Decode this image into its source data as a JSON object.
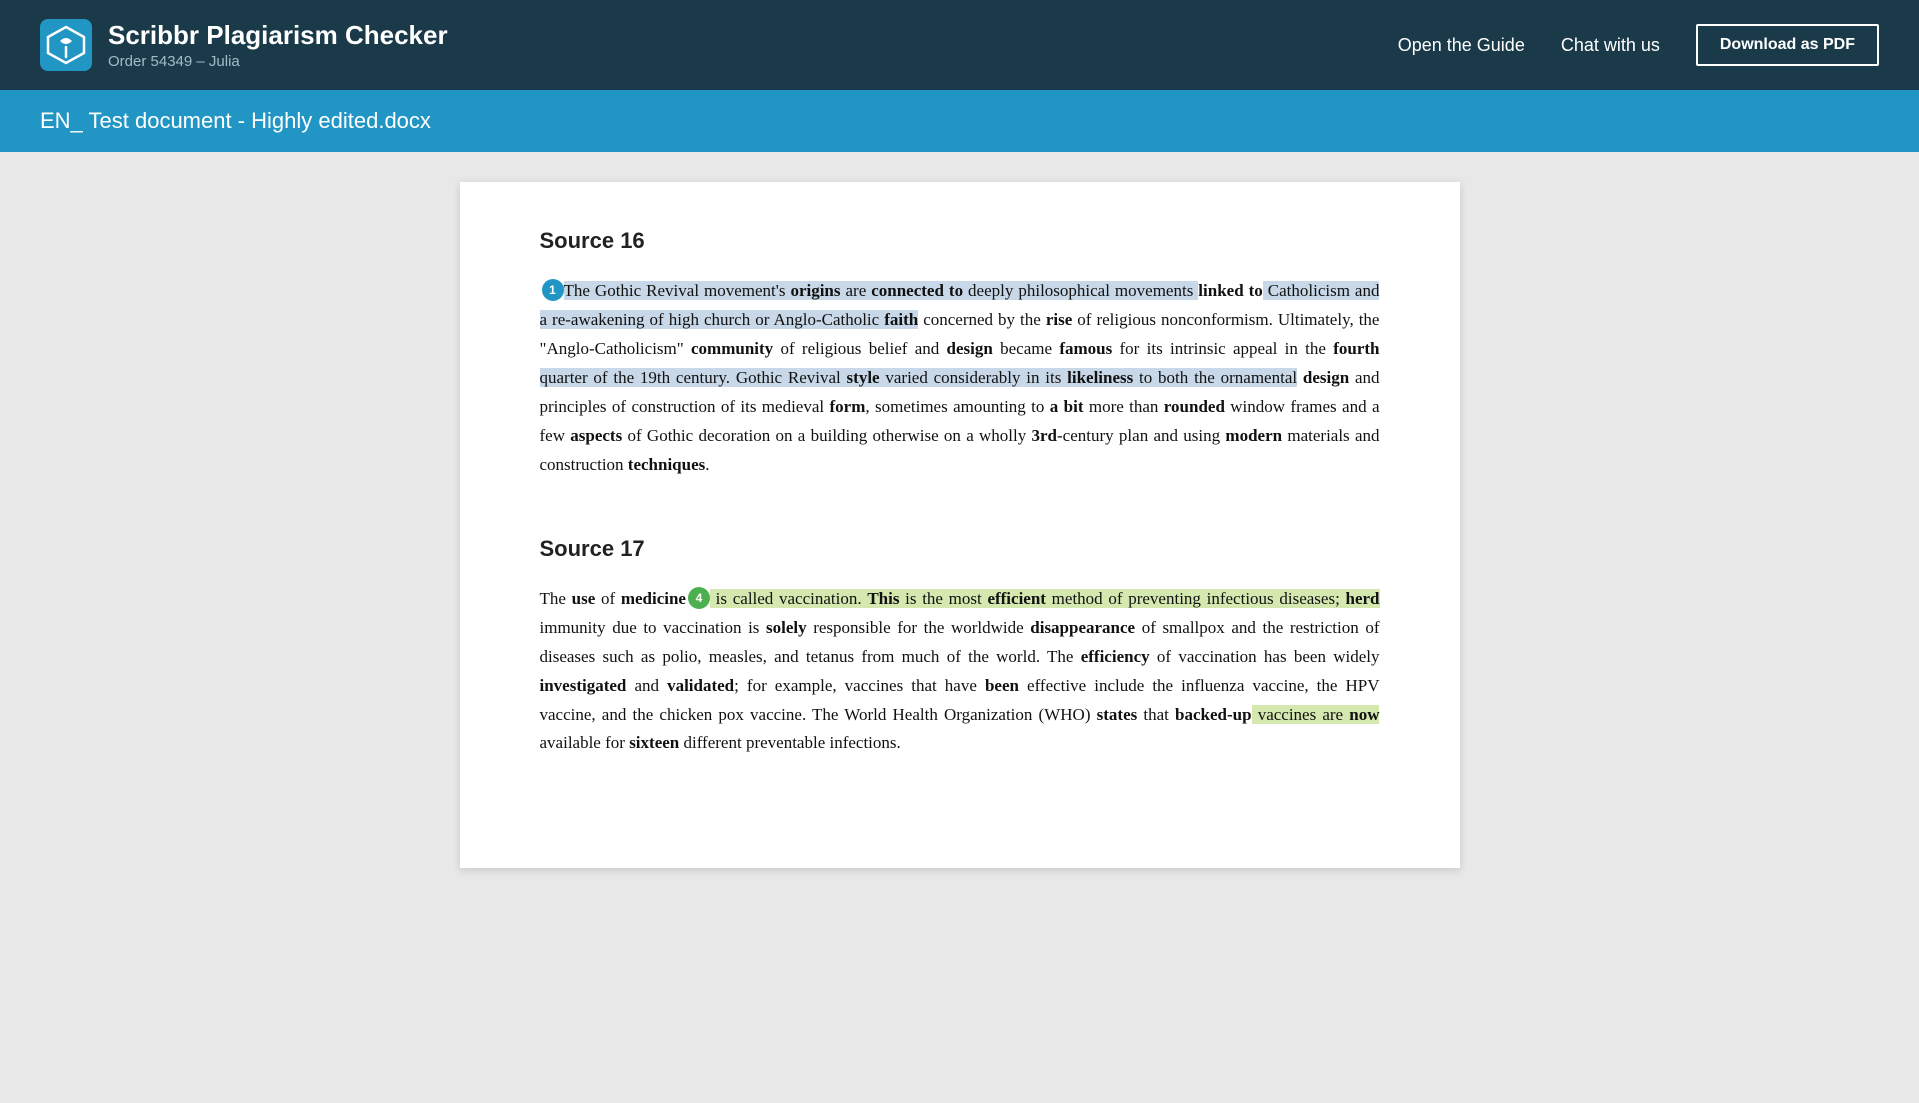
{
  "header": {
    "app_name": "Scribbr Plagiarism Checker",
    "order_info": "Order 54349 – Julia",
    "nav_guide": "Open the Guide",
    "nav_chat": "Chat with us",
    "download_btn": "Download as PDF"
  },
  "blue_bar": {
    "filename": "EN_ Test document - Highly edited.docx"
  },
  "sources": [
    {
      "id": "source-16",
      "heading": "Source 16",
      "badge_num": "1",
      "badge_color": "blue",
      "paragraph_segments": [
        {
          "text": "The Gothic Revival movement's ",
          "style": "hl-blue"
        },
        {
          "text": "origins",
          "style": "hl-blue bold"
        },
        {
          "text": " are ",
          "style": "hl-blue"
        },
        {
          "text": "connected to",
          "style": "hl-blue bold"
        },
        {
          "text": " deeply philosophical movements ",
          "style": "hl-blue"
        },
        {
          "text": "linked to",
          "style": "bold"
        },
        {
          "text": " Catholicism and a re-awakening of high church or Anglo-Catholic ",
          "style": "hl-blue"
        },
        {
          "text": "faith",
          "style": "hl-blue bold"
        },
        {
          "text": " concerned by the ",
          "style": ""
        },
        {
          "text": "rise",
          "style": "bold"
        },
        {
          "text": " of religious nonconformism. Ultimately, the \"Anglo-Catholicism\" ",
          "style": ""
        },
        {
          "text": "community",
          "style": "bold"
        },
        {
          "text": " of religious belief and ",
          "style": ""
        },
        {
          "text": "design",
          "style": "bold"
        },
        {
          "text": " became ",
          "style": ""
        },
        {
          "text": "famous",
          "style": "bold"
        },
        {
          "text": " for its intrinsic appeal in the ",
          "style": ""
        },
        {
          "text": "fourth",
          "style": "bold"
        },
        {
          "text": " quarter of the 19th century. Gothic Revival ",
          "style": "hl-blue"
        },
        {
          "text": "style",
          "style": "hl-blue bold"
        },
        {
          "text": " varied considerably in its ",
          "style": "hl-blue"
        },
        {
          "text": "likeliness",
          "style": "hl-blue bold"
        },
        {
          "text": " to both the ornamental ",
          "style": "hl-blue"
        },
        {
          "text": "design",
          "style": "bold"
        },
        {
          "text": " and principles of construction of its medieval ",
          "style": ""
        },
        {
          "text": "form",
          "style": "bold"
        },
        {
          "text": ", sometimes amounting to ",
          "style": ""
        },
        {
          "text": "a bit",
          "style": "bold"
        },
        {
          "text": " more than ",
          "style": ""
        },
        {
          "text": "rounded",
          "style": "bold"
        },
        {
          "text": " window frames and a few ",
          "style": ""
        },
        {
          "text": "aspects",
          "style": "bold"
        },
        {
          "text": " of Gothic decoration on a building otherwise on a wholly ",
          "style": ""
        },
        {
          "text": "3rd",
          "style": "bold"
        },
        {
          "text": "-century plan and using ",
          "style": ""
        },
        {
          "text": "modern",
          "style": "bold"
        },
        {
          "text": " materials and construction ",
          "style": ""
        },
        {
          "text": "techniques",
          "style": "bold"
        },
        {
          "text": ".",
          "style": ""
        }
      ]
    },
    {
      "id": "source-17",
      "heading": "Source 17",
      "badge_num": "4",
      "badge_color": "green",
      "paragraph_segments": [
        {
          "text": "The ",
          "style": ""
        },
        {
          "text": "use",
          "style": "bold"
        },
        {
          "text": " of ",
          "style": ""
        },
        {
          "text": "medicine",
          "style": "bold"
        },
        {
          "text": " is called vaccination. ",
          "style": "hl-yellow"
        },
        {
          "text": "This",
          "style": "bold"
        },
        {
          "text": " is the most ",
          "style": ""
        },
        {
          "text": "efficient",
          "style": "bold"
        },
        {
          "text": " method of preventing infectious diseases; ",
          "style": "hl-yellow"
        },
        {
          "text": "herd",
          "style": "bold"
        },
        {
          "text": " immunity due to vaccination is ",
          "style": ""
        },
        {
          "text": "solely",
          "style": "bold"
        },
        {
          "text": " responsible for the worldwide ",
          "style": ""
        },
        {
          "text": "disappearance",
          "style": "bold"
        },
        {
          "text": " of smallpox and the restriction of diseases such as polio, measles, and tetanus from much of the world. The ",
          "style": ""
        },
        {
          "text": "efficiency",
          "style": "bold"
        },
        {
          "text": " of vaccination has been widely ",
          "style": ""
        },
        {
          "text": "investigated",
          "style": "bold"
        },
        {
          "text": " and ",
          "style": ""
        },
        {
          "text": "validated",
          "style": "bold"
        },
        {
          "text": "; for example, vaccines that have ",
          "style": ""
        },
        {
          "text": "been",
          "style": "bold"
        },
        {
          "text": " effective include the influenza vaccine, the HPV vaccine, and the chicken pox vaccine. The World Health Organization (WHO) ",
          "style": ""
        },
        {
          "text": "states",
          "style": "bold"
        },
        {
          "text": " that ",
          "style": ""
        },
        {
          "text": "backed-up",
          "style": "bold"
        },
        {
          "text": " vaccines are ",
          "style": "hl-yellow"
        },
        {
          "text": "now",
          "style": "bold"
        },
        {
          "text": " available for ",
          "style": ""
        },
        {
          "text": "sixteen",
          "style": "bold"
        },
        {
          "text": " different preventable infections.",
          "style": ""
        }
      ]
    }
  ]
}
